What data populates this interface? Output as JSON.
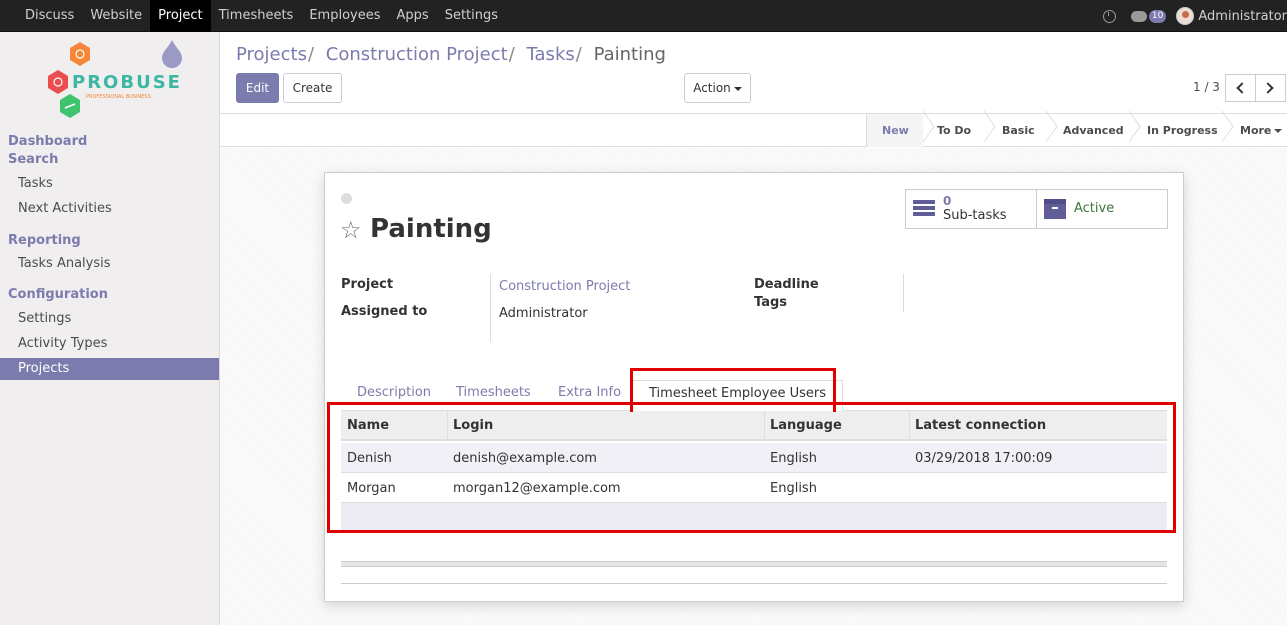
{
  "topbar": {
    "menu": [
      "Discuss",
      "Website",
      "Project",
      "Timesheets",
      "Employees",
      "Apps",
      "Settings"
    ],
    "active_index": 2,
    "badge": "10",
    "username": "Administrator"
  },
  "sidebar": {
    "logo_text": "PROBUSE",
    "logo_sub": "PROFESSIONAL BUSINESS",
    "sections": [
      {
        "label": "Dashboard",
        "items": []
      },
      {
        "label": "Search",
        "items": [
          "Tasks",
          "Next Activities"
        ]
      },
      {
        "label": "Reporting",
        "items": [
          "Tasks Analysis"
        ]
      },
      {
        "label": "Configuration",
        "items": [
          "Settings",
          "Activity Types",
          "Projects"
        ]
      }
    ],
    "active_item": "Projects"
  },
  "breadcrumb": {
    "items": [
      "Projects",
      "Construction Project",
      "Tasks"
    ],
    "current": "Painting"
  },
  "buttons": {
    "edit": "Edit",
    "create": "Create",
    "action": "Action"
  },
  "pager": {
    "value": "1 / 3"
  },
  "stages": [
    "New",
    "To Do",
    "Basic",
    "Advanced",
    "In Progress",
    "More"
  ],
  "current_stage": "New",
  "record": {
    "title": "Painting",
    "subtasks_count": "0",
    "subtasks_label": "Sub-tasks",
    "active_label": "Active",
    "fields": {
      "project_label": "Project",
      "project_value": "Construction Project",
      "assigned_label": "Assigned to",
      "assigned_value": "Administrator",
      "deadline_label": "Deadline",
      "tags_label": "Tags"
    }
  },
  "tabs": [
    "Description",
    "Timesheets",
    "Extra Info",
    "Timesheet Employee Users"
  ],
  "active_tab": "Timesheet Employee Users",
  "table": {
    "columns": [
      "Name",
      "Login",
      "Language",
      "Latest connection"
    ],
    "rows": [
      [
        "Denish",
        "denish@example.com",
        "English",
        "03/29/2018 17:00:09"
      ],
      [
        "Morgan",
        "morgan12@example.com",
        "English",
        ""
      ]
    ]
  },
  "colors": {
    "accent": "#7c7bad",
    "highlight": "#e00000",
    "topbar": "#222222"
  }
}
